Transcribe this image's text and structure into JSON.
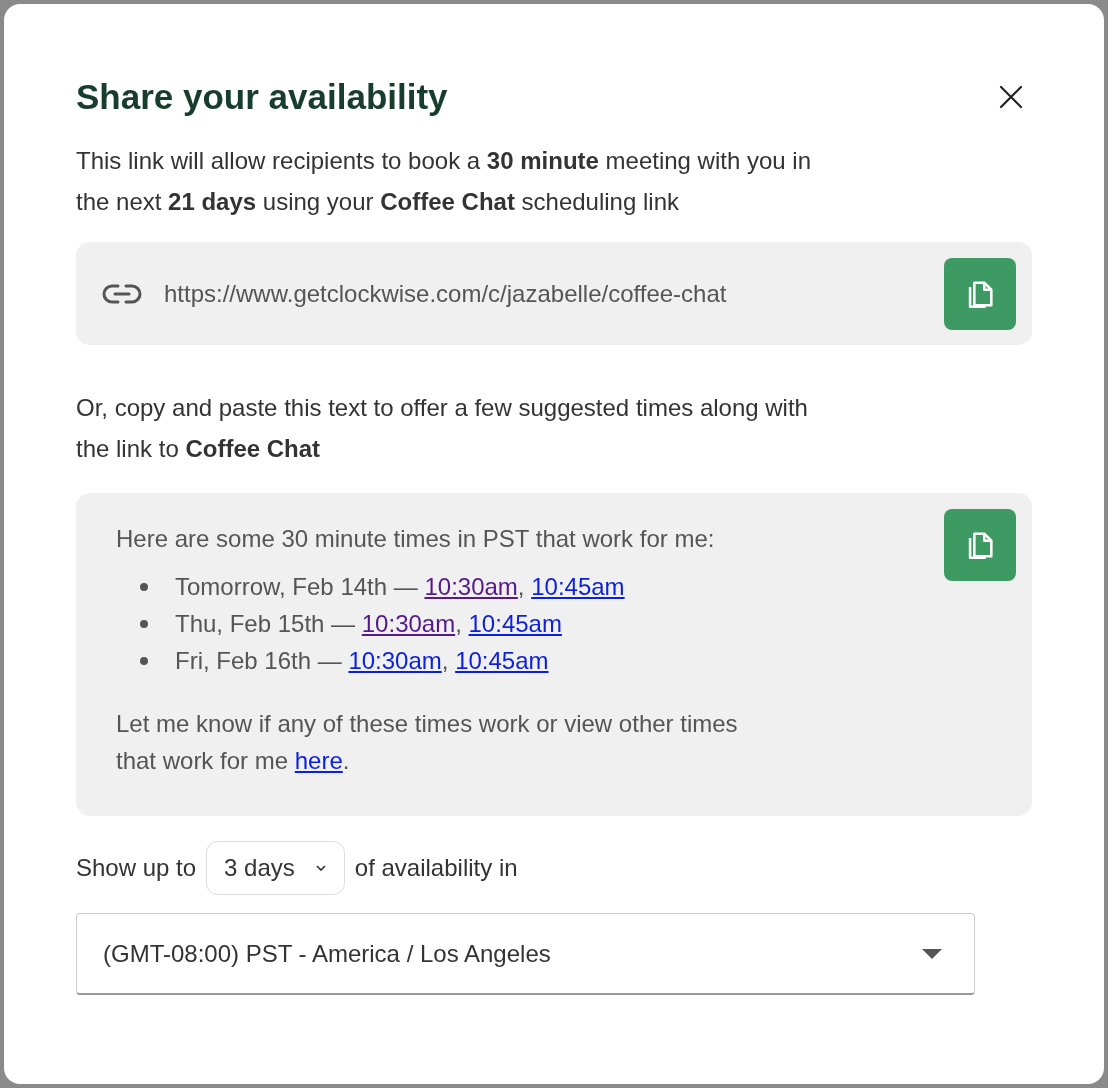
{
  "dialog": {
    "title": "Share your availability"
  },
  "intro": "This link will allow recipients to book a **30 minute** meeting with you in the next **21 days** using your **Coffee Chat** scheduling link",
  "link_box": {
    "url": "https://www.getclockwise.com/c/jazabelle/coffee-chat"
  },
  "suggest_intro": "Or, copy and paste this text to offer a few suggested times along with the link to **Coffee Chat**",
  "message": {
    "heading": "Here are some 30 minute times in PST that work for me:",
    "days": [
      {
        "label": "Tomorrow, Feb 14th —",
        "separator": ",",
        "times": [
          {
            "text": "10:30am",
            "visited": true
          },
          {
            "text": "10:45am",
            "visited": false
          }
        ]
      },
      {
        "label": "Thu, Feb 15th —",
        "separator": ",",
        "times": [
          {
            "text": "10:30am",
            "visited": true
          },
          {
            "text": "10:45am",
            "visited": false
          }
        ]
      },
      {
        "label": "Fri, Feb 16th —",
        "separator": ",",
        "times": [
          {
            "text": "10:30am",
            "visited": false
          },
          {
            "text": "10:45am",
            "visited": false
          }
        ]
      }
    ],
    "footer_text": "Let me know if any of these times work or view other times that work for me",
    "footer_link": "here",
    "footer_end": "."
  },
  "range": {
    "prefix": "Show up to",
    "value": "3 days",
    "suffix": "of availability in"
  },
  "timezone": {
    "value": "(GMT-08:00) PST - America / Los Angeles"
  }
}
